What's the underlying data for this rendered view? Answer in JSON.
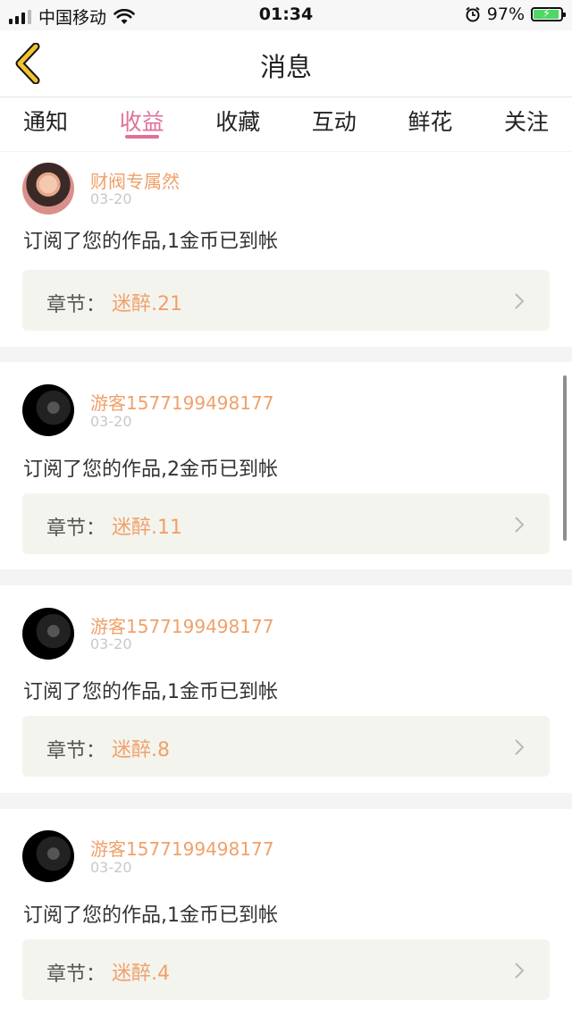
{
  "status_bar": {
    "carrier": "中国移动",
    "time": "01:34",
    "battery": "97%",
    "icons": [
      "signal-icon",
      "wifi-icon",
      "alarm-icon",
      "battery-icon"
    ]
  },
  "header": {
    "title": "消息",
    "back_icon": "chevron-left-icon"
  },
  "tabs": [
    {
      "label": "通知"
    },
    {
      "label": "收益",
      "active": true
    },
    {
      "label": "收藏"
    },
    {
      "label": "互动"
    },
    {
      "label": "鲜花"
    },
    {
      "label": "关注"
    }
  ],
  "colors": {
    "accent": "#e0709a",
    "name": "#f0a06a",
    "date": "#c8c8c8",
    "back": "#f2c230"
  },
  "messages": [
    {
      "user": "财阀专属然",
      "date": "03-20",
      "text": "订阅了您的作品,1金币已到帐",
      "chapter_label": "章节：",
      "chapter": "迷醉.21"
    },
    {
      "user": "游客1577199498177",
      "date": "03-20",
      "text": "订阅了您的作品,2金币已到帐",
      "chapter_label": "章节：",
      "chapter": "迷醉.11"
    },
    {
      "user": "游客1577199498177",
      "date": "03-20",
      "text": "订阅了您的作品,1金币已到帐",
      "chapter_label": "章节：",
      "chapter": "迷醉.8"
    },
    {
      "user": "游客1577199498177",
      "date": "03-20",
      "text": "订阅了您的作品,1金币已到帐",
      "chapter_label": "章节：",
      "chapter": "迷醉.4"
    }
  ]
}
